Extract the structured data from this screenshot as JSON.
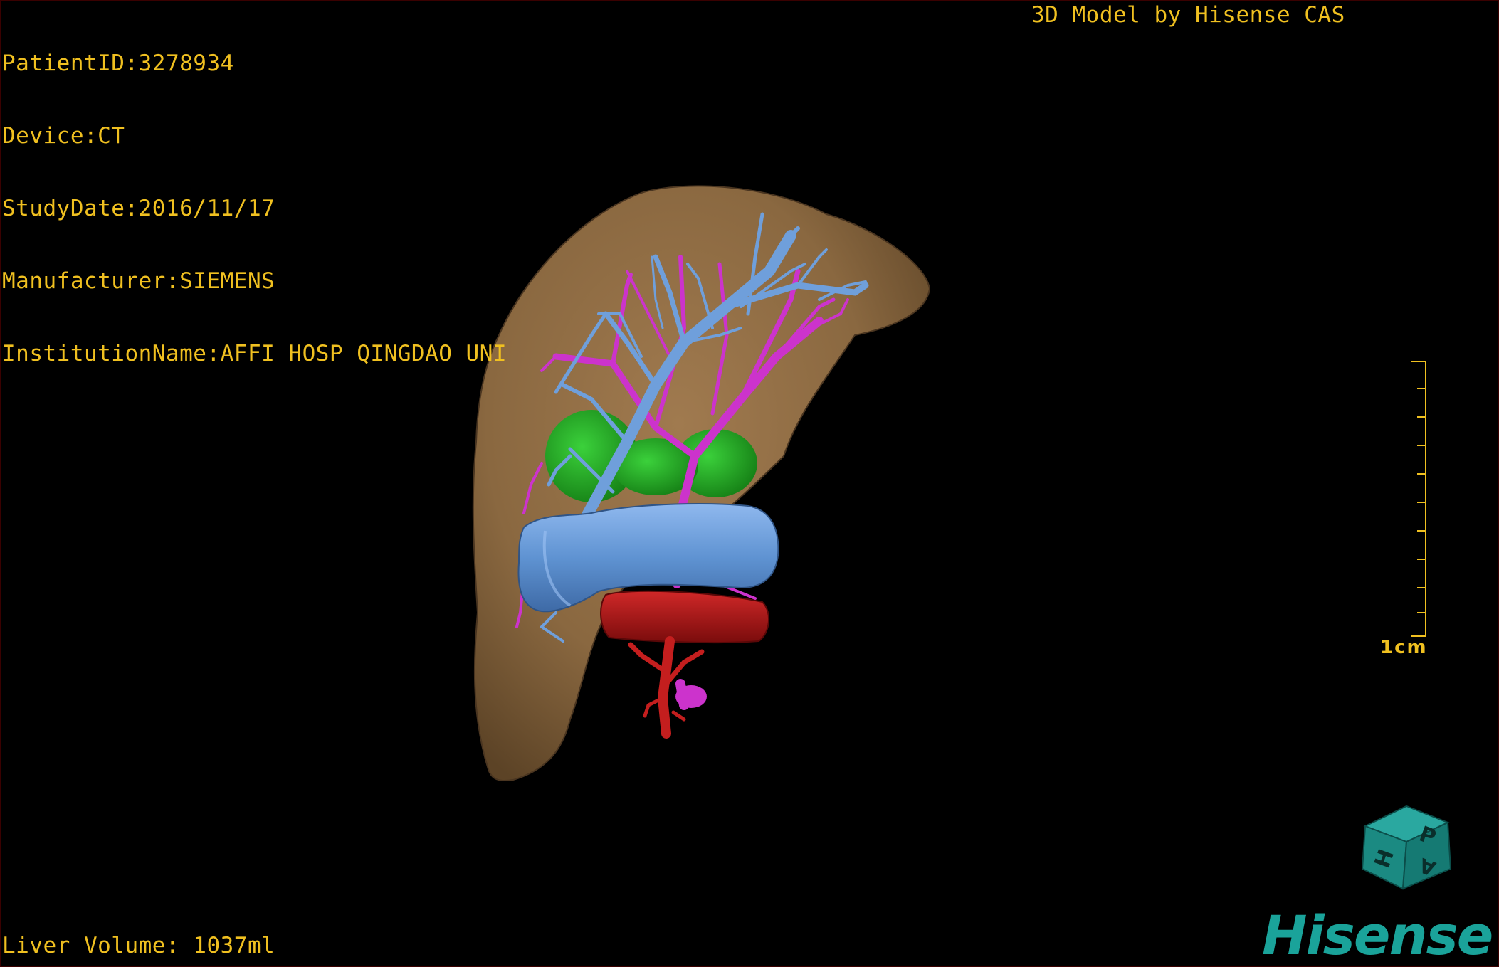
{
  "overlay": {
    "patient_id": "PatientID:3278934",
    "device": "Device:CT",
    "study_date": "StudyDate:2016/11/17",
    "manufacturer": "Manufacturer:SIEMENS",
    "institution": "InstitutionName:AFFI HOSP QINGDAO UNI",
    "model_credit": "3D Model by Hisense CAS",
    "liver_volume": "Liver Volume: 1037ml"
  },
  "scale": {
    "label": "1cm"
  },
  "orientation_cube": {
    "face_labels": [
      "P",
      "H",
      "A"
    ]
  },
  "brand": {
    "name": "Hisense"
  },
  "colors": {
    "overlay_text": "#f0c020",
    "liver": "#8c6a45",
    "hepatic_vein": "#6a9bd6",
    "portal_vein": "#cc33cc",
    "artery": "#b01818",
    "tumor": "#1fa41f",
    "brand": "#1aa39a"
  }
}
